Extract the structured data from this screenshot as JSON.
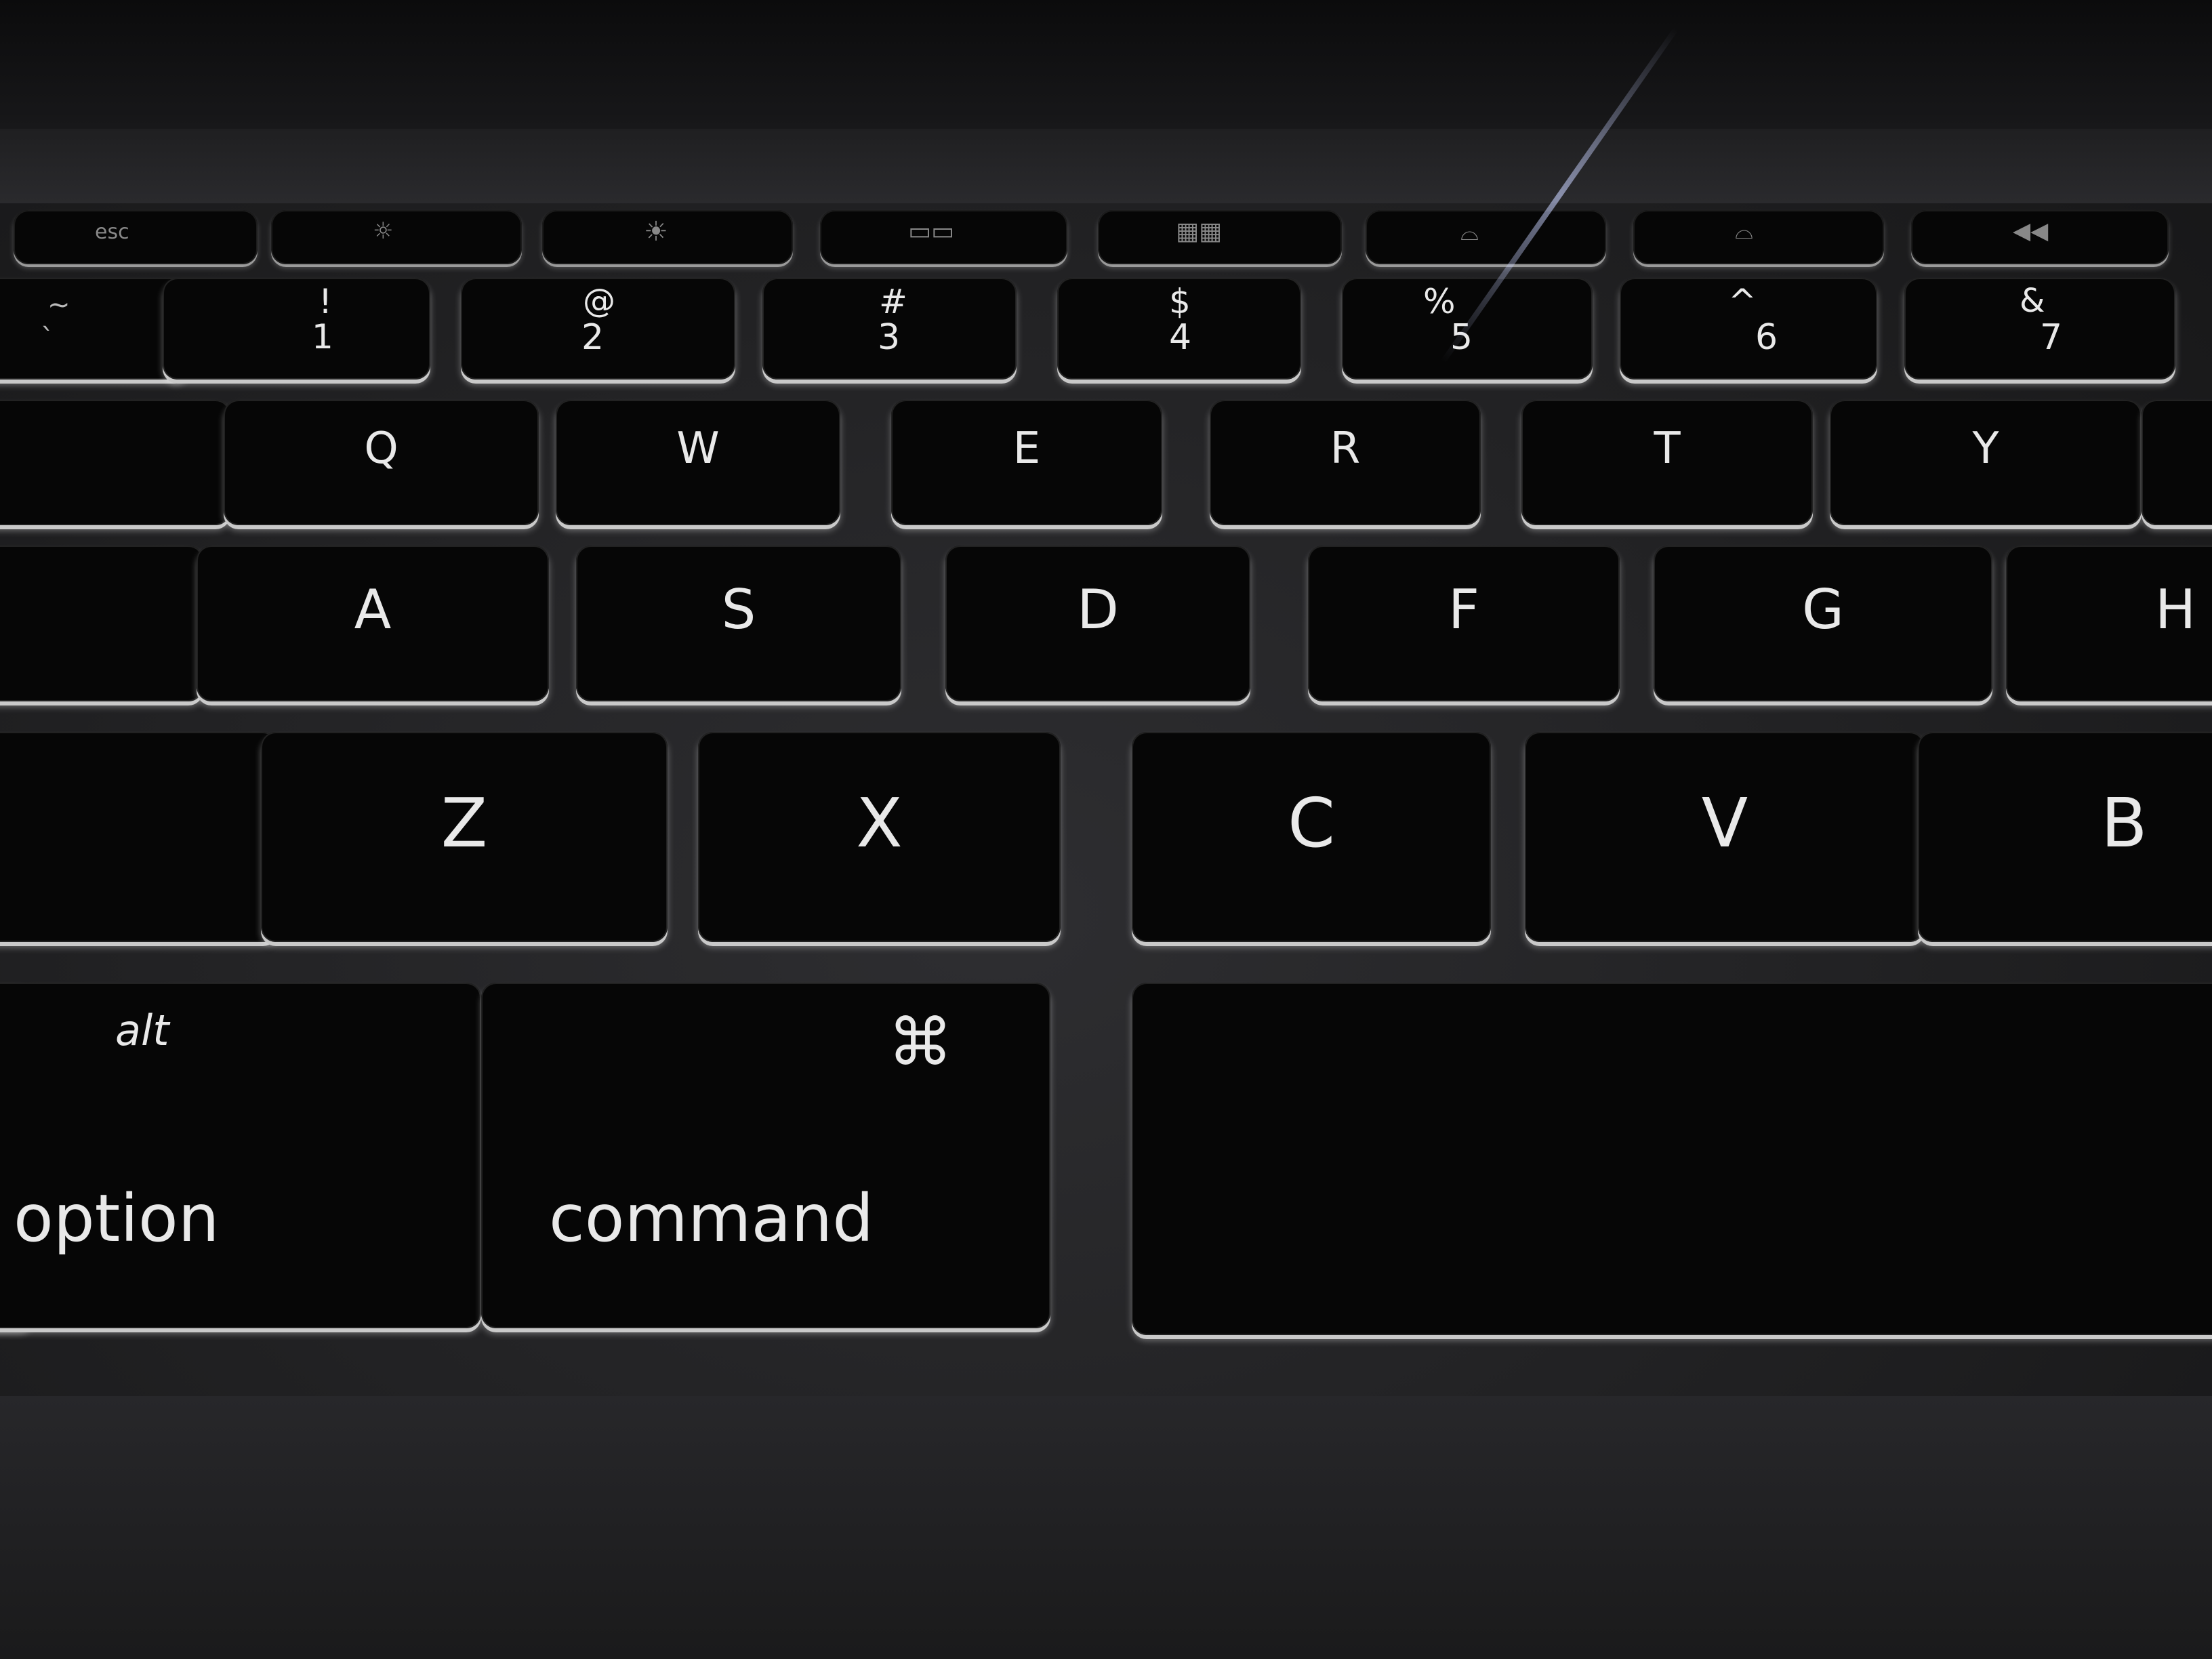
{
  "keyboard": {
    "function_row": {
      "esc": "esc"
    },
    "number_row": [
      {
        "top": "~",
        "bottom": "`"
      },
      {
        "top": "!",
        "bottom": "1"
      },
      {
        "top": "@",
        "bottom": "2"
      },
      {
        "top": "#",
        "bottom": "3"
      },
      {
        "top": "$",
        "bottom": "4"
      },
      {
        "top": "%",
        "bottom": "5"
      },
      {
        "top": "^",
        "bottom": "6"
      },
      {
        "top": "&",
        "bottom": "7"
      }
    ],
    "qwerty_row": [
      "Q",
      "W",
      "E",
      "R",
      "T",
      "Y"
    ],
    "home_row": [
      "A",
      "S",
      "D",
      "F",
      "G",
      "H"
    ],
    "bottom_row": [
      "Z",
      "X",
      "C",
      "V",
      "B"
    ],
    "modifiers": {
      "option_top": "alt",
      "option_bottom": "option",
      "command_symbol": "⌘",
      "command_label": "command"
    }
  }
}
